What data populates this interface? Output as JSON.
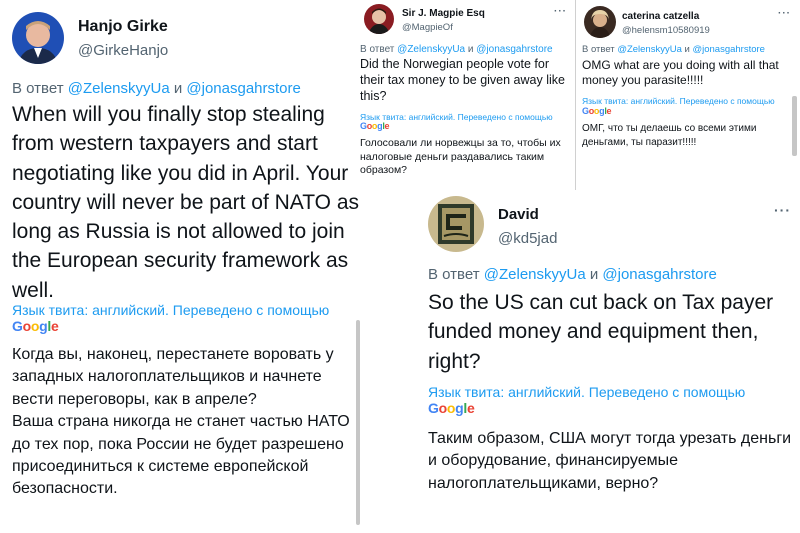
{
  "tweets": [
    {
      "name": "Hanjo Girke",
      "handle": "@GirkeHanjo",
      "reply_prefix": "В ответ ",
      "reply_mention_1": "@ZelenskyyUa",
      "reply_joiner": " и ",
      "reply_mention_2": "@jonasgahrstore",
      "text": "When will you finally stop stealing from western taxpayers and start negotiating like you did in April. Your country will never be part of NATO as long as Russia is not allowed to join the European security framework as well.",
      "translated_note": "Язык твита: английский. Переведено с помощью",
      "translation": "Когда вы, наконец, перестанете воровать у западных налогоплательщиков и начнете вести переговоры, как в апреле?\nВаша страна никогда не станет частью НАТО до тех пор, пока России не будет разрешено присоединиться к системе европейской безопасности."
    },
    {
      "name": "Sir J. Magpie Esq",
      "handle": "@MagpieOf",
      "more": "···",
      "reply_prefix": "В ответ ",
      "reply_mention_1": "@ZelenskyyUa",
      "reply_joiner": " и ",
      "reply_mention_2": "@jonasgahrstore",
      "text": "Did the Norwegian people vote for their tax money to be given away like this?",
      "translated_note": "Язык твита: английский. Переведено с помощью",
      "translation": "Голосовали ли норвежцы за то, чтобы их налоговые деньги раздавались таким образом?"
    },
    {
      "name": "caterina catzella",
      "handle": "@helensm10580919",
      "more": "···",
      "reply_prefix": "В ответ ",
      "reply_mention_1": "@ZelenskyyUa",
      "reply_joiner": " и ",
      "reply_mention_2": "@jonasgahrstore",
      "text": "OMG what are you doing with all that money you parasite!!!!!",
      "translated_note": "Язык твита: английский. Переведено с помощью",
      "translation": "ОМГ, что ты делаешь со всеми этими деньгами, ты паразит!!!!!"
    },
    {
      "name": "David",
      "handle": "@kd5jad",
      "more": "···",
      "reply_prefix": "В ответ ",
      "reply_mention_1": "@ZelenskyyUa",
      "reply_joiner": " и ",
      "reply_mention_2": "@jonasgahrstore",
      "text": "So the US can cut back on Tax payer funded money and equipment then, right?",
      "translated_note": "Язык твита: английский. Переведено с помощью",
      "translation": "Таким образом, США могут тогда урезать деньги и оборудование, финансируемые налогоплательщиками, верно?"
    }
  ],
  "google_logo": {
    "g1": "G",
    "o1": "o",
    "o2": "o",
    "g2": "g",
    "l": "l",
    "e": "e"
  },
  "colors": {
    "mention": "#1d9bf0",
    "text": "#0f1419",
    "secondary": "#536471",
    "google_blue": "#4285f4",
    "google_red": "#ea4335",
    "google_yellow": "#fbbc05",
    "google_green": "#34a853"
  },
  "icons": [
    "more-options-icon"
  ]
}
